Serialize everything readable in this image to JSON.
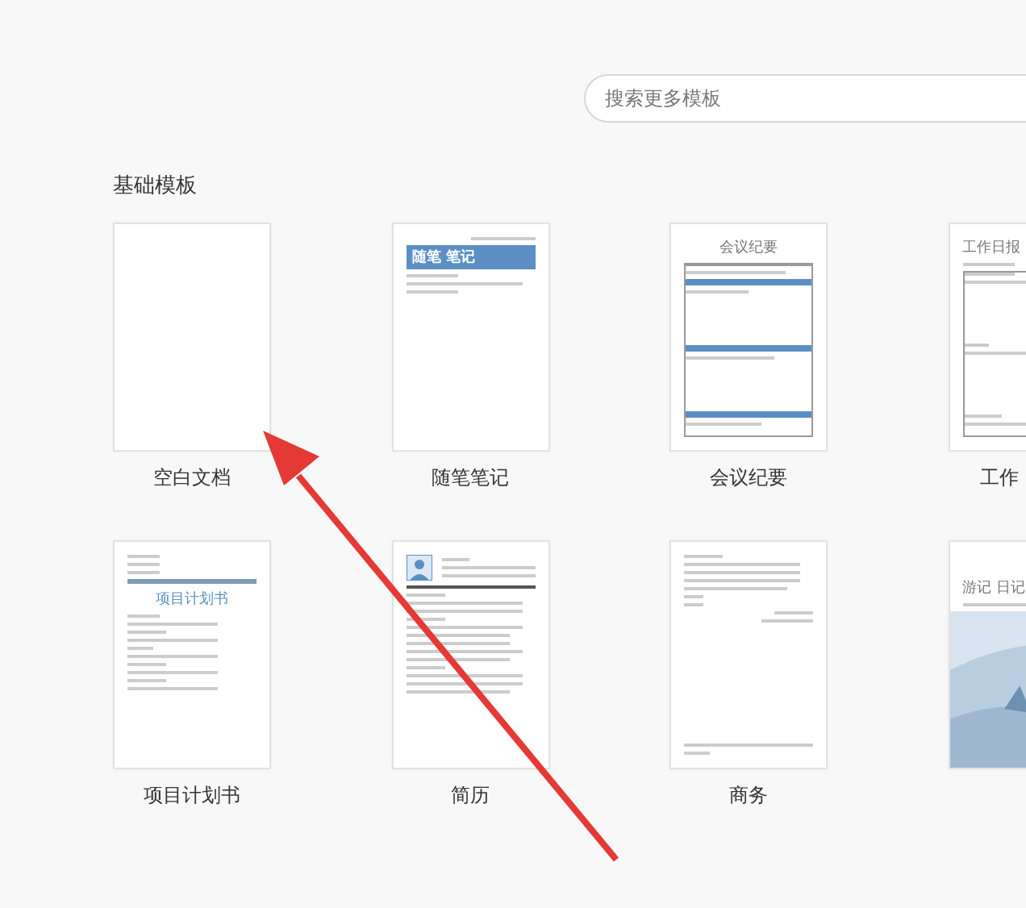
{
  "search": {
    "placeholder": "搜索更多模板"
  },
  "section": {
    "title": "基础模板"
  },
  "templates": [
    {
      "kind": "blank",
      "label": "空白文档"
    },
    {
      "kind": "notes",
      "label": "随笔笔记",
      "heading": "随笔 笔记"
    },
    {
      "kind": "minutes",
      "label": "会议纪要",
      "heading": "会议纪要"
    },
    {
      "kind": "daily",
      "label": "工作",
      "heading": "工作日报"
    },
    {
      "kind": "plan",
      "label": "项目计划书",
      "heading": "项目计划书"
    },
    {
      "kind": "resume",
      "label": "简历"
    },
    {
      "kind": "letter",
      "label": "商务"
    },
    {
      "kind": "travel",
      "heading": "游记 日记"
    }
  ]
}
